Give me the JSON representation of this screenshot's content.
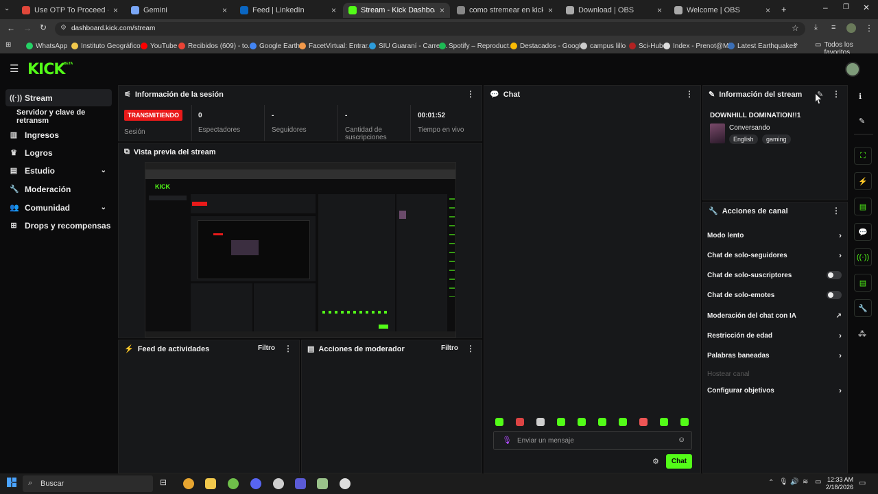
{
  "browser": {
    "tabs": [
      {
        "label": "Use OTP To Proceed - tomasto",
        "color": "#e0473a"
      },
      {
        "label": "Gemini",
        "color": "#7aa7f7"
      },
      {
        "label": "Feed | LinkedIn",
        "color": "#0a66c2"
      },
      {
        "label": "Stream - Kick Dashboard",
        "color": "#53fc18"
      },
      {
        "label": "como stremear en kick - Buscar",
        "color": "#888888"
      },
      {
        "label": "Download | OBS",
        "color": "#aaaaaa"
      },
      {
        "label": "Welcome | OBS",
        "color": "#aaaaaa"
      }
    ],
    "url": "dashboard.kick.com/stream",
    "bookmarks": [
      {
        "label": "WhatsApp",
        "color": "#25d366"
      },
      {
        "label": "Instituto Geográfico...",
        "color": "#f2c94c"
      },
      {
        "label": "YouTube",
        "color": "#ff0000"
      },
      {
        "label": "Recibidos (609) - to...",
        "color": "#ea4335"
      },
      {
        "label": "Google Earth",
        "color": "#4285f4"
      },
      {
        "label": "FacetVirtual: Entrar...",
        "color": "#f2994a"
      },
      {
        "label": "SIU Guaraní - Carrer...",
        "color": "#2d9cdb"
      },
      {
        "label": "Spotify – Reproduct...",
        "color": "#1db954"
      },
      {
        "label": "Destacados - Googl...",
        "color": "#fbbc05"
      },
      {
        "label": "campus lillo",
        "color": "#cccccc"
      },
      {
        "label": "Sci-Hub",
        "color": "#b22222"
      },
      {
        "label": "Index - Prenot@Mi",
        "color": "#dddddd"
      },
      {
        "label": "Latest Earthquakes",
        "color": "#3b6fb6"
      }
    ],
    "all_favorites": "Todos los favoritos"
  },
  "kick": {
    "logo": "KICK",
    "logo_badge": "BETA",
    "brand_color": "#53fc18"
  },
  "sidebar": {
    "items": [
      {
        "label": "Stream",
        "icon": "broadcast-icon",
        "glyph": "((·))"
      },
      {
        "label": "Servidor y clave de retransm",
        "icon": "",
        "glyph": ""
      },
      {
        "label": "Ingresos",
        "icon": "chart-icon",
        "glyph": "▥"
      },
      {
        "label": "Logros",
        "icon": "trophy-icon",
        "glyph": "♛"
      },
      {
        "label": "Estudio",
        "icon": "studio-icon",
        "glyph": "▤"
      },
      {
        "label": "Moderación",
        "icon": "wrench-icon",
        "glyph": "🔧"
      },
      {
        "label": "Comunidad",
        "icon": "people-icon",
        "glyph": "👥"
      },
      {
        "label": "Drops y recompensas",
        "icon": "gift-icon",
        "glyph": "⊞"
      }
    ]
  },
  "session": {
    "title": "Información de la sesión",
    "status_badge": "TRANSMITIENDO",
    "status_label": "Sesión",
    "stats": [
      {
        "value": "0",
        "label": "Espectadores"
      },
      {
        "value": "-",
        "label": "Seguidores"
      },
      {
        "value": "-",
        "label": "Cantidad de suscripciones"
      },
      {
        "value": "00:01:52",
        "label": "Tiempo en vivo"
      }
    ]
  },
  "preview": {
    "title": "Vista previa del stream"
  },
  "activity": {
    "title": "Feed de actividades",
    "filter": "Filtro"
  },
  "mod_actions": {
    "title": "Acciones de moderador",
    "filter": "Filtro"
  },
  "chat": {
    "title": "Chat",
    "placeholder": "Enviar un mensaje",
    "send": "Chat"
  },
  "stream_info": {
    "title": "Información del stream",
    "stream_title": "DOWNHILL DOMINATION!!1",
    "category": "Conversando",
    "tags": [
      "English",
      "gaming"
    ]
  },
  "channel_actions": {
    "title": "Acciones de canal",
    "items": [
      {
        "label": "Modo lento",
        "kind": "arrow"
      },
      {
        "label": "Chat de solo-seguidores",
        "kind": "arrow"
      },
      {
        "label": "Chat de solo-suscriptores",
        "kind": "toggle"
      },
      {
        "label": "Chat de solo-emotes",
        "kind": "toggle"
      },
      {
        "label": "Moderación del chat con IA",
        "kind": "external"
      },
      {
        "label": "Restricción de edad",
        "kind": "arrow"
      },
      {
        "label": "Palabras baneadas",
        "kind": "arrow"
      },
      {
        "label": "Hostear canal",
        "kind": "disabled"
      },
      {
        "label": "Configurar objetivos",
        "kind": "arrow"
      }
    ]
  },
  "taskbar": {
    "search": "Buscar",
    "time": "12:33 AM",
    "date": "2/18/2026"
  }
}
